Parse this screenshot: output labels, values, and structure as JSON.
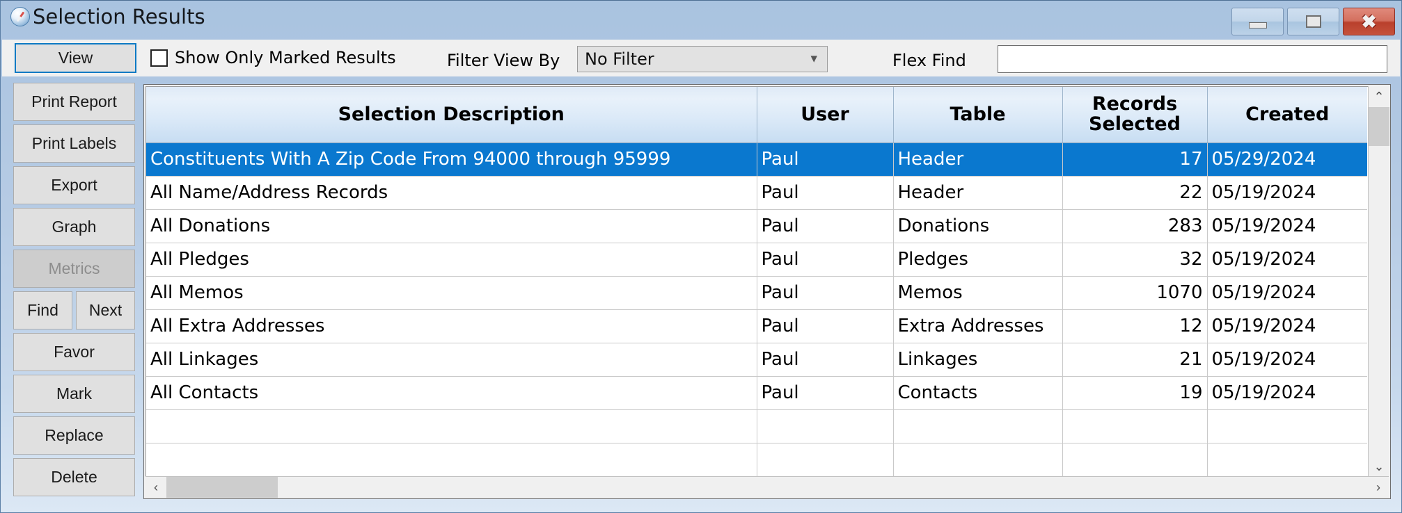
{
  "window": {
    "title": "Selection Results",
    "icon": "compass-icon",
    "controls": {
      "minimize": "–",
      "maximize": "□",
      "close": "✕"
    },
    "accent_blue": "#0a78cf",
    "titlebar_blue": "#a9c3e0",
    "close_red": "#b9402c"
  },
  "toolbar": {
    "view_label": "View",
    "show_only_marked_label": "Show Only Marked Results",
    "show_only_marked_checked": false,
    "filter_view_by_label": "Filter View By",
    "filter_value": "No Filter",
    "filter_options": [
      "No Filter"
    ],
    "flex_find_label": "Flex Find",
    "flex_find_value": "",
    "flex_find_placeholder": ""
  },
  "sidebar": {
    "items": [
      {
        "label": "Print Report",
        "disabled": false
      },
      {
        "label": "Print Labels",
        "disabled": false
      },
      {
        "label": "Export",
        "disabled": false
      },
      {
        "label": "Graph",
        "disabled": false
      },
      {
        "label": "Metrics",
        "disabled": true
      },
      {
        "label": "Find",
        "disabled": false
      },
      {
        "label": "Next",
        "disabled": false
      },
      {
        "label": "Favor",
        "disabled": false
      },
      {
        "label": "Mark",
        "disabled": false
      },
      {
        "label": "Replace",
        "disabled": false
      },
      {
        "label": "Delete",
        "disabled": false
      }
    ]
  },
  "grid": {
    "columns": [
      {
        "key": "description",
        "label": "Selection Description"
      },
      {
        "key": "user",
        "label": "User"
      },
      {
        "key": "table",
        "label": "Table"
      },
      {
        "key": "records_selected",
        "label_line1": "Records",
        "label_line2": "Selected"
      },
      {
        "key": "created",
        "label": "Created"
      }
    ],
    "rows": [
      {
        "description": "Constituents With A Zip Code From 94000 through 95999",
        "user": "Paul",
        "table": "Header",
        "records_selected": "17",
        "created": "05/29/2024",
        "selected": true
      },
      {
        "description": "All Name/Address Records",
        "user": "Paul",
        "table": "Header",
        "records_selected": "22",
        "created": "05/19/2024",
        "selected": false
      },
      {
        "description": "All Donations",
        "user": "Paul",
        "table": "Donations",
        "records_selected": "283",
        "created": "05/19/2024",
        "selected": false
      },
      {
        "description": "All Pledges",
        "user": "Paul",
        "table": "Pledges",
        "records_selected": "32",
        "created": "05/19/2024",
        "selected": false
      },
      {
        "description": "All Memos",
        "user": "Paul",
        "table": "Memos",
        "records_selected": "1070",
        "created": "05/19/2024",
        "selected": false
      },
      {
        "description": "All Extra Addresses",
        "user": "Paul",
        "table": "Extra Addresses",
        "records_selected": "12",
        "created": "05/19/2024",
        "selected": false
      },
      {
        "description": "All Linkages",
        "user": "Paul",
        "table": "Linkages",
        "records_selected": "21",
        "created": "05/19/2024",
        "selected": false
      },
      {
        "description": "All Contacts",
        "user": "Paul",
        "table": "Contacts",
        "records_selected": "19",
        "created": "05/19/2024",
        "selected": false
      }
    ]
  },
  "scrollbars": {
    "vertical": {
      "up_arrow": "⌃",
      "down_arrow": "⌄"
    },
    "horizontal": {
      "left_arrow": "‹",
      "right_arrow": "›"
    }
  }
}
